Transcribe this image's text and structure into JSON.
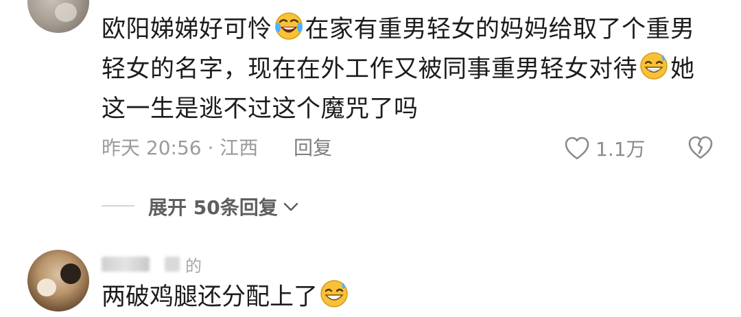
{
  "comment": {
    "lines": [
      [
        "欧阳娣娣好可怜",
        "在家有重男轻女的妈妈给取了个重男"
      ],
      [
        "轻女的名字，现在在外工作又被同事重男轻女对待",
        "她"
      ],
      [
        "这一生是逃不过这个魔咒了吗"
      ]
    ],
    "emoji_1": "laugh-cry-emoji",
    "emoji_2": "sweat-smile-emoji",
    "time_location": "昨天 20:56 · 江西",
    "reply_label": "回复",
    "like_count": "1.1万",
    "like_icon": "heart-outline-icon",
    "dislike_icon": "broken-heart-icon"
  },
  "replies": {
    "expand_label": "展开 50条回复",
    "expand_icon": "chevron-down-icon"
  },
  "reply_comment": {
    "username_suffix": "的",
    "text": "两破鸡腿还分配上了",
    "emoji": "sweat-smile-emoji"
  }
}
